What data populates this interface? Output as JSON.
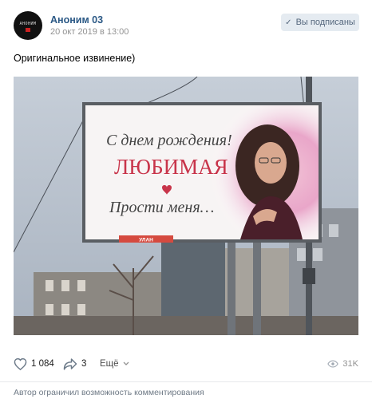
{
  "post": {
    "author": "Аноним 03",
    "date": "20 окт 2019 в 13:00",
    "subscribe_label": "Вы подписаны",
    "text": "Оригинальное извинение)",
    "avatar_text": "АНОНИМ"
  },
  "billboard": {
    "line1": "С днем рождения!",
    "line2": "ЛЮБИМАЯ",
    "line3": "Прости меня…",
    "small_sign": "УЛАН"
  },
  "actions": {
    "likes": "1 084",
    "shares": "3",
    "more_label": "Ещё",
    "views": "31K"
  },
  "footer": {
    "comments_disabled": "Автор ограничил возможность комментирования"
  },
  "icons": {
    "like": "heart-icon",
    "share": "share-arrow-icon",
    "more": "chevron-down-icon",
    "views": "eye-icon",
    "subscribed": "check-icon"
  },
  "colors": {
    "link": "#2a5885",
    "button_bg": "#e5ebf1",
    "button_text": "#55677d",
    "muted": "#939393",
    "billboard_red": "#c8344a"
  }
}
